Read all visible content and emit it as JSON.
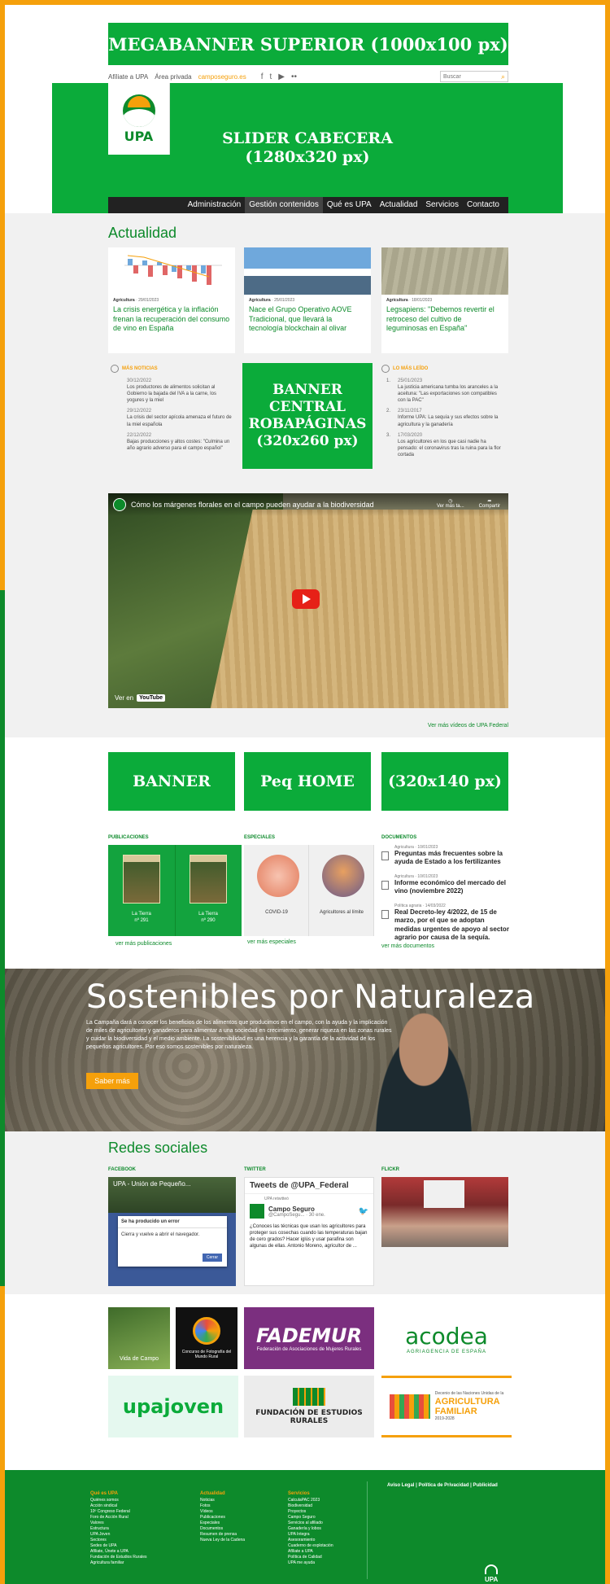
{
  "ads": {
    "megabanner": "MEGABANNER SUPERIOR (1000x100 px)",
    "slider_line1": "SLIDER CABECERA",
    "slider_line2": "(1280x320 px)",
    "robapaginas_line1": "BANNER",
    "robapaginas_line2": "CENTRAL",
    "robapaginas_line3": "ROBAPÁGINAS",
    "robapaginas_line4": "(320x260 px)",
    "peq_1": "BANNER",
    "peq_2": "Peq HOME",
    "peq_3": "(320x140 px)"
  },
  "utility": {
    "afiliate": "Afíliate a UPA",
    "area": "Área privada",
    "campo": "camposeguro.es",
    "search_placeholder": "Buscar"
  },
  "logo": {
    "text": "UPA"
  },
  "nav": [
    "Administración",
    "Gestión contenidos",
    "Qué es UPA",
    "Actualidad",
    "Servicios",
    "Contacto"
  ],
  "actualidad": {
    "title": "Actualidad",
    "cards": [
      {
        "category": "Agricultura",
        "date": "· 29/01/2023",
        "title": "La crisis energética y la inflación frenan la recuperación del consumo de vino en España"
      },
      {
        "category": "Agricultura",
        "date": "· 25/01/2023",
        "title": "Nace el Grupo Operativo AOVE Tradicional, que llevará la tecnología blockchain al olivar"
      },
      {
        "category": "Agricultura",
        "date": "· 18/01/2023",
        "title": "Legsapiens: \"Debemos revertir el retroceso del cultivo de leguminosas en España\""
      }
    ]
  },
  "mas_noticias": {
    "title": "MÁS NOTICIAS",
    "items": [
      {
        "date": "30/12/2022",
        "text": "Los productores de alimentos solicitan al Gobierno la bajada del IVA a la carne, los yogures y la miel"
      },
      {
        "date": "29/12/2022",
        "text": "La crisis del sector apícola amenaza el futuro de la miel española"
      },
      {
        "date": "22/12/2022",
        "text": "Bajas producciones y altos costes: \"Culmina un año agrario adverso para el campo español\""
      }
    ]
  },
  "lo_mas_leido": {
    "title": "LO MÁS LEÍDO",
    "items": [
      {
        "num": "1.",
        "date": "25/01/2023",
        "text": "La justicia americana tumba los aranceles a la aceituna: \"Las exportaciones son compatibles con la PAC\""
      },
      {
        "num": "2.",
        "date": "23/11/2017",
        "text": "Informe UPA: La sequía y sus efectos sobre la agricultura y la ganadería"
      },
      {
        "num": "3.",
        "date": "17/03/2020",
        "text": "Los agricultores en los que casi nadie ha pensado: el coronavirus tras la ruina para la flor cortada"
      }
    ]
  },
  "video": {
    "title": "Cómo los márgenes florales en el campo pueden ayudar a la biodiversidad",
    "watch_later": "Ver más ta...",
    "share": "Compartir",
    "watch_on": "Ver en",
    "youtube": "YouTube",
    "more_link": "Ver más vídeos de UPA Federal"
  },
  "publicaciones": {
    "title": "PUBLICACIONES",
    "items": [
      {
        "name": "La Tierra",
        "num": "nº 291"
      },
      {
        "name": "La Tierra",
        "num": "nº 290"
      }
    ],
    "more": "ver más publicaciones"
  },
  "especiales": {
    "title": "ESPECIALES",
    "items": [
      "COVID-19",
      "Agricultores al límite"
    ],
    "more": "ver más especiales"
  },
  "documentos": {
    "title": "DOCUMENTOS",
    "items": [
      {
        "meta": "Agricultura · 10/01/2023",
        "title": "Preguntas más frecuentes sobre la ayuda de Estado a los fertilizantes"
      },
      {
        "meta": "Agricultura · 10/01/2023",
        "title": "Informe económico del mercado del vino (noviembre 2022)"
      },
      {
        "meta": "Política agraria · 14/03/2022",
        "title": "Real Decreto-ley 4/2022, de 15 de marzo, por el que se adoptan medidas urgentes de apoyo al sector agrario por causa de la sequía."
      }
    ],
    "more": "ver más documentos"
  },
  "hero": {
    "headline": "Sostenibles por Naturaleza",
    "description": "La Campaña dará a conocer los beneficios de los alimentos que producimos en el campo, con la ayuda y la implicación de miles de agricultores y ganaderos para alimentar a una sociedad en crecimiento, generar riqueza en las zonas rurales y cuidar la biodiversidad y el medio ambiente. La sostenibilidad es una herencia y la garantía de la actividad de los pequeños agricultores. Por eso somos sostenibles por naturaleza.",
    "cta": "Saber más"
  },
  "redes": {
    "title": "Redes sociales",
    "facebook": {
      "label": "FACEBOOK",
      "page": "UPA - Unión de Pequeño...",
      "error_title": "Se ha producido un error",
      "error_msg": "Cierra y vuelve a abrir el navegador.",
      "close": "Cerrar"
    },
    "twitter": {
      "label": "TWITTER",
      "header": "Tweets de @UPA_Federal",
      "retweeted": "UPA retwitteó",
      "user": "Campo Seguro",
      "handle": "@CampoSegu... · 30 ene.",
      "text": "¿Conoces las técnicas que usan los agricultores para proteger sus cosechas cuando las temperaturas bajan de cero grados? Hacer iglús y usar parafina son algunas de ellas. Antonio Moreno, agricultor de ..."
    },
    "flickr": {
      "label": "FLICKR"
    }
  },
  "partners": {
    "p1_caption": "Vida de Campo",
    "p2_caption": "Concurso de Fotografía del Mundo Rural",
    "p3_big": "FADEMUR",
    "p3_small": "Federación de Asociaciones de Mujeres Rurales",
    "p4_big": "acodea",
    "p4_small": "AGRIAGENCIA DE ESPAÑA",
    "p5_big": "upajoven",
    "p6_small": "FUNDACIÓN DE ESTUDIOS RURALES",
    "p7_line1": "Decenio de las Naciones Unidas de la",
    "p7_em1": "AGRICULTURA",
    "p7_em2": "FAMILIAR",
    "p7_years": "2019-2028"
  },
  "footer": {
    "col1": {
      "title": "Qué es UPA",
      "items": [
        "Quiénes somos",
        "Acción sindical",
        "10º Congreso Federal",
        "Foro de Acción Rural",
        "Valores",
        "Estructura",
        "UPA Joven",
        "Sectores",
        "Sedes de UPA",
        "Afíliate, Únete a UPA",
        "Fundación de Estudios Rurales",
        "Agricultura familiar"
      ]
    },
    "col2": {
      "title": "Actualidad",
      "items": [
        "Noticias",
        "Fotos",
        "Vídeos",
        "Publicaciones",
        "Especiales",
        "Documentos",
        "Resumen de prensa",
        "Nueva Ley de la Cadena"
      ]
    },
    "col3": {
      "title": "Servicios",
      "items": [
        "CalculaPAC 2023",
        "Biodiversidad",
        "Proyectos",
        "Campo Seguro",
        "Servicios al afiliado",
        "Ganadería y lobos",
        "UPA Integra",
        "Asesoramiento",
        "Cuaderno de explotación",
        "Afíliate a UPA",
        "Política de Calidad",
        "UPA me ayuda"
      ]
    },
    "legal": "Aviso Legal  |  Política de Privacidad  |  Publicidad",
    "logo": "UPA"
  },
  "colors": {
    "brand_green": "#0d8a2b",
    "ad_green": "#0bab3a",
    "accent_orange": "#f5a00b"
  }
}
